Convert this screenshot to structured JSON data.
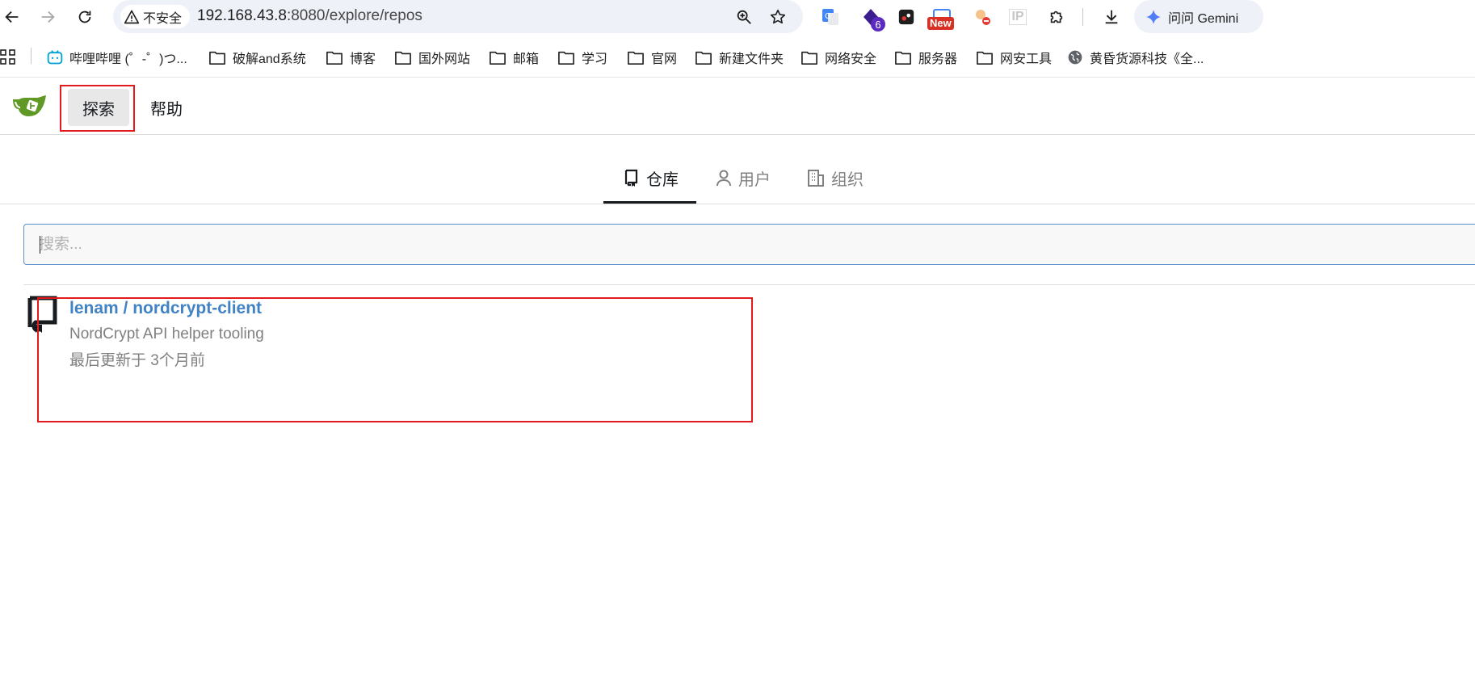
{
  "browser": {
    "security_label": "不安全",
    "url_host": "192.168.43.8",
    "url_path": ":8080/explore/repos",
    "gemini_label": "问问 Gemini",
    "ext_badge_count": "6",
    "ext_new_label": "New",
    "ext_ip_label": "IP"
  },
  "bookmarks": [
    {
      "label": "哔哩哔哩 (゜-゜)つ...",
      "icon": "bilibili-icon"
    },
    {
      "label": "破解and系统",
      "icon": "folder-icon"
    },
    {
      "label": "博客",
      "icon": "folder-icon"
    },
    {
      "label": "国外网站",
      "icon": "folder-icon"
    },
    {
      "label": "邮箱",
      "icon": "folder-icon"
    },
    {
      "label": "学习",
      "icon": "folder-icon"
    },
    {
      "label": "官网",
      "icon": "folder-icon"
    },
    {
      "label": "新建文件夹",
      "icon": "folder-icon"
    },
    {
      "label": "网络安全",
      "icon": "folder-icon"
    },
    {
      "label": "服务器",
      "icon": "folder-icon"
    },
    {
      "label": "网安工具",
      "icon": "folder-icon"
    },
    {
      "label": "黄昏货源科技《全...",
      "icon": "globe-icon"
    }
  ],
  "nav": {
    "explore_label": "探索",
    "help_label": "帮助"
  },
  "tabs": [
    {
      "label": "仓库",
      "active": true
    },
    {
      "label": "用户",
      "active": false
    },
    {
      "label": "组织",
      "active": false
    }
  ],
  "search": {
    "placeholder": "搜索...",
    "value": ""
  },
  "repos": [
    {
      "name": "lenam / nordcrypt-client",
      "description": "NordCrypt API helper tooling",
      "updated": "最后更新于 3个月前"
    }
  ],
  "colors": {
    "link": "#4183c4",
    "annotation_box": "#e31a1c",
    "gitea_green": "#609926"
  }
}
